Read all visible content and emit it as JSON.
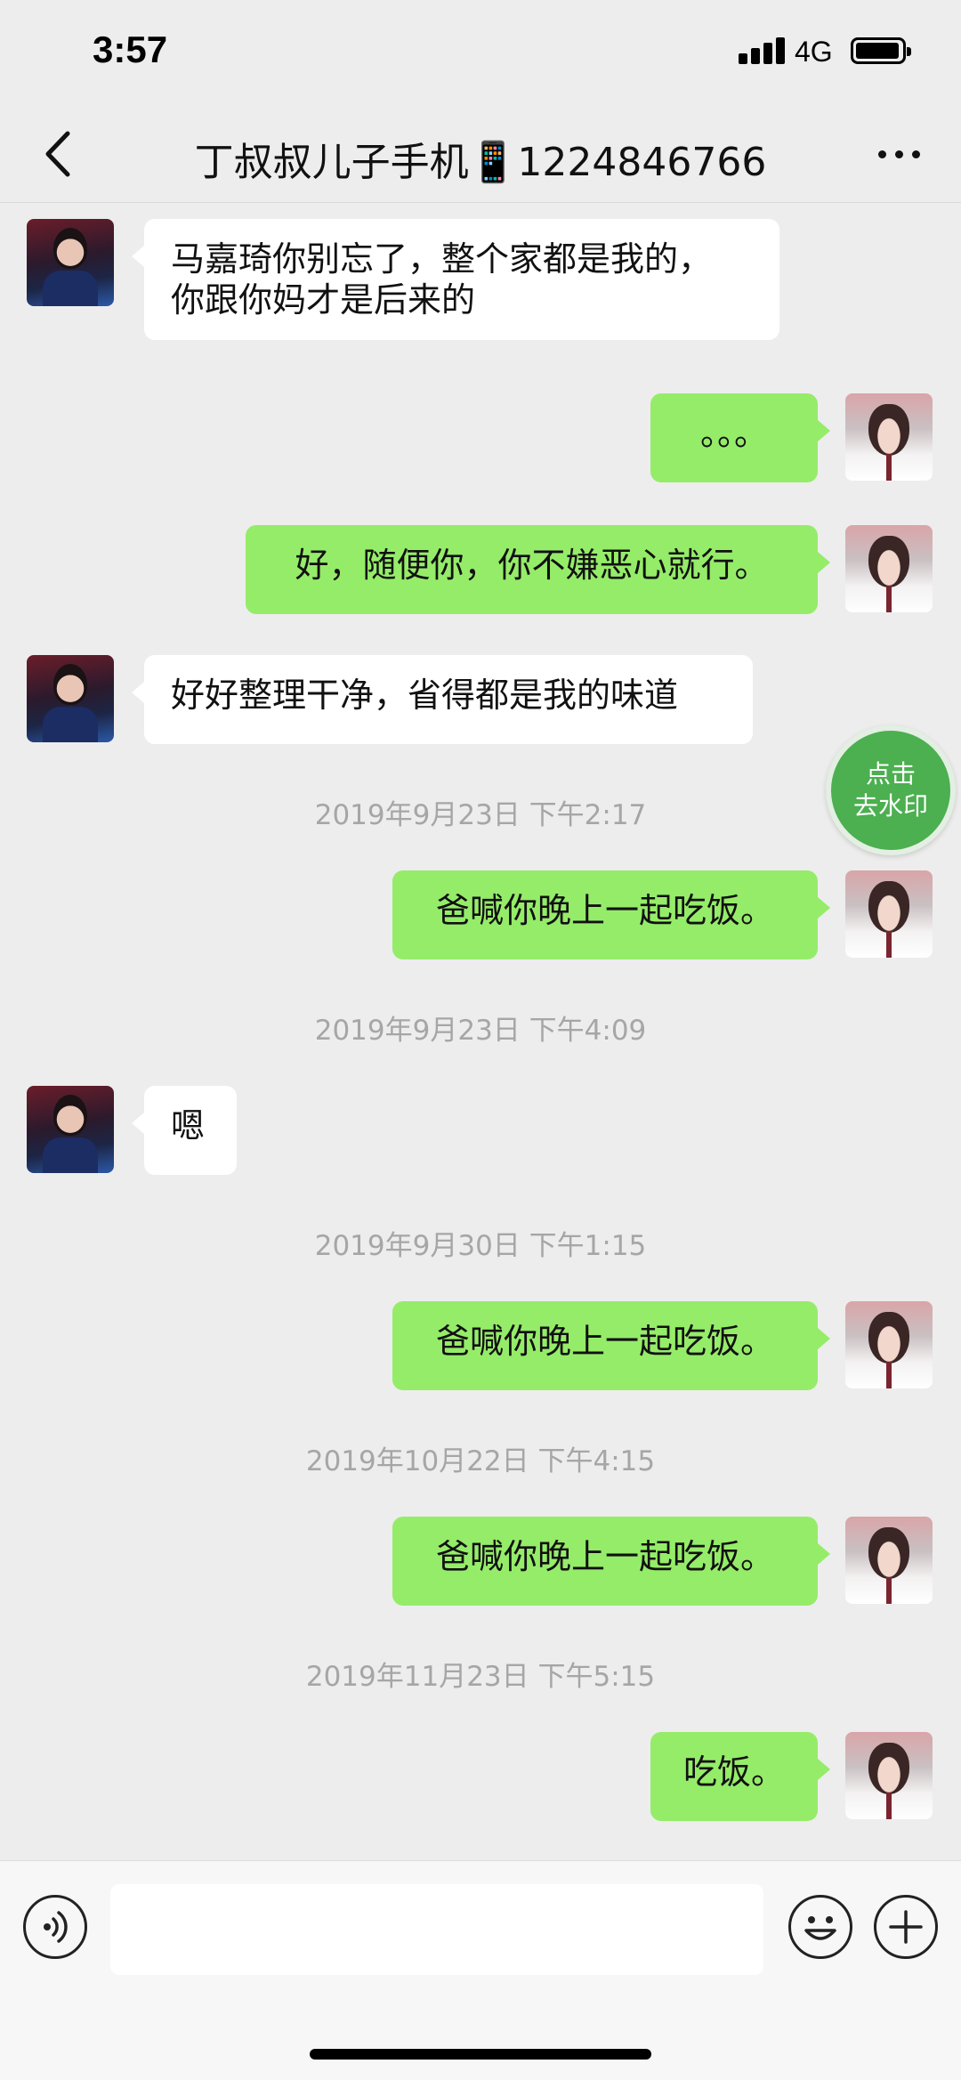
{
  "status_bar": {
    "time": "3:57",
    "network": "4G",
    "icons": [
      "signal-icon",
      "battery-icon"
    ]
  },
  "nav": {
    "back_icon": "chevron-left-icon",
    "title": "丁叔叔儿子手机📱1224846766",
    "more_icon": "more-icon"
  },
  "messages": [
    {
      "type": "in",
      "text_lines": [
        "马嘉琦你别忘了，整个家都是我的，",
        "你跟你妈才是后来的"
      ]
    },
    {
      "type": "out",
      "text": "。。。"
    },
    {
      "type": "out",
      "text": "好，随便你，你不嫌恶心就行。"
    },
    {
      "type": "in",
      "text": "好好整理干净，省得都是我的味道"
    },
    {
      "type": "time",
      "text": "2019年9月23日 下午2:17"
    },
    {
      "type": "out",
      "text": "爸喊你晚上一起吃饭。"
    },
    {
      "type": "time",
      "text": "2019年9月23日 下午4:09"
    },
    {
      "type": "in",
      "text": "嗯"
    },
    {
      "type": "time",
      "text": "2019年9月30日 下午1:15"
    },
    {
      "type": "out",
      "text": "爸喊你晚上一起吃饭。"
    },
    {
      "type": "time",
      "text": "2019年10月22日 下午4:15"
    },
    {
      "type": "out",
      "text": "爸喊你晚上一起吃饭。"
    },
    {
      "type": "time",
      "text": "2019年11月23日 下午5:15"
    },
    {
      "type": "out",
      "text": "吃饭。"
    }
  ],
  "float_button": {
    "line1": "点击",
    "line2": "去水印"
  },
  "input_bar": {
    "voice_icon": "voice-icon",
    "input_value": "",
    "emoji_icon": "emoji-icon",
    "plus_icon": "plus-icon"
  },
  "colors": {
    "outgoing_bubble": "#95ec69",
    "incoming_bubble": "#ffffff",
    "background": "#ededed",
    "float_button": "#4caf50"
  }
}
